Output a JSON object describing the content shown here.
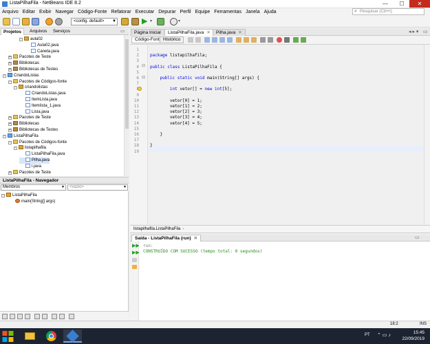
{
  "window": {
    "title": "ListaPilhaFila - NetBeans IDE 8.2",
    "controls": [
      "—",
      "☐",
      "✕"
    ]
  },
  "menu": [
    "Arquivo",
    "Editar",
    "Exibir",
    "Navegar",
    "Código-Fonte",
    "Refatorar",
    "Executar",
    "Depurar",
    "Perfil",
    "Equipe",
    "Ferramentas",
    "Janela",
    "Ajuda"
  ],
  "search": {
    "placeholder": "Pesquisar (Ctrl+I)"
  },
  "toolbar": {
    "config": "<config. default>"
  },
  "project_tabs": [
    "Projetos",
    "Arquivos",
    "Serviços"
  ],
  "project_tree": [
    {
      "label": "aula02",
      "type": "pkg",
      "indent": 3,
      "toggle": "-"
    },
    {
      "label": "Aula02.java",
      "type": "java",
      "indent": 4,
      "toggle": ""
    },
    {
      "label": "Caneta.java",
      "type": "java",
      "indent": 4,
      "toggle": ""
    },
    {
      "label": "Pacotes de Teste",
      "type": "folder",
      "indent": 1,
      "toggle": "+"
    },
    {
      "label": "Bibliotecas",
      "type": "lib",
      "indent": 1,
      "toggle": "+"
    },
    {
      "label": "Bibliotecas de Testes",
      "type": "lib",
      "indent": 1,
      "toggle": "+"
    },
    {
      "label": "CriandoListas",
      "type": "proj",
      "indent": 0,
      "toggle": "-"
    },
    {
      "label": "Pacotes de Códigos-fonte",
      "type": "folder",
      "indent": 1,
      "toggle": "-"
    },
    {
      "label": "criandolistas",
      "type": "pkg",
      "indent": 2,
      "toggle": "-"
    },
    {
      "label": "CriandoListas.java",
      "type": "java",
      "indent": 3,
      "toggle": ""
    },
    {
      "label": "ItemLista.java",
      "type": "java",
      "indent": 3,
      "toggle": ""
    },
    {
      "label": "ItemIista_1.java",
      "type": "java",
      "indent": 3,
      "toggle": ""
    },
    {
      "label": "Lista.java",
      "type": "java",
      "indent": 3,
      "toggle": ""
    },
    {
      "label": "Pacotes de Teste",
      "type": "folder",
      "indent": 1,
      "toggle": "+"
    },
    {
      "label": "Bibliotecas",
      "type": "lib",
      "indent": 1,
      "toggle": "+"
    },
    {
      "label": "Bibliotecas de Testes",
      "type": "lib",
      "indent": 1,
      "toggle": "+"
    },
    {
      "label": "ListaPilhaFila",
      "type": "proj",
      "indent": 0,
      "toggle": "-"
    },
    {
      "label": "Pacotes de Códigos-fonte",
      "type": "folder",
      "indent": 1,
      "toggle": "-"
    },
    {
      "label": "listapilhafila",
      "type": "pkg",
      "indent": 2,
      "toggle": "-"
    },
    {
      "label": "ListaPilhaFila.java",
      "type": "java",
      "indent": 3,
      "toggle": ""
    },
    {
      "label": "Pilha.java",
      "type": "java",
      "indent": 3,
      "toggle": ""
    },
    {
      "label": "i.java",
      "type": "java",
      "indent": 3,
      "toggle": ""
    },
    {
      "label": "Pacotes de Teste",
      "type": "folder",
      "indent": 1,
      "toggle": "+"
    }
  ],
  "navigator": {
    "title": "ListaPilhaFila - Navegador",
    "filter": "Membros",
    "filter2": "<vazio>",
    "class_node": "ListaPilhaFila",
    "method_node": "main(String[] args)"
  },
  "editor_tabs": [
    {
      "label": "Página Inicial",
      "active": false
    },
    {
      "label": "ListaPilhaFila.java",
      "active": true
    },
    {
      "label": "Pilha.java",
      "active": false
    }
  ],
  "editor_modes": [
    "Código-Fonte",
    "Histórico"
  ],
  "code_lines": [
    "",
    "package listapilhafila;",
    "",
    "public class ListaPilhaFila {",
    "",
    "    public static void main(String[] args) {",
    "",
    "        int vetor[] = new int[5];",
    "",
    "        vetor[0] = 1;",
    "        vetor[1] = 2;",
    "        vetor[2] = 3;",
    "        vetor[3] = 4;",
    "        vetor[4] = 5;",
    "",
    "    }",
    "",
    "}",
    ""
  ],
  "breadcrumb": "listapilhafila.ListaPilhaFila",
  "output": {
    "title": "Saída - ListaPilhaFila (run)",
    "lines": [
      "run:",
      "CONSTRUÍDO COM SUCESSO (tempo total: 0 segundos)"
    ]
  },
  "status": {
    "position": "18:2",
    "mode": "INS"
  },
  "taskbar": {
    "lang": "PT",
    "time": "15:45",
    "date": "22/09/2019"
  },
  "colors": {
    "keyword": "#0000e6",
    "success": "#2c8a1e",
    "run": "#777777"
  }
}
